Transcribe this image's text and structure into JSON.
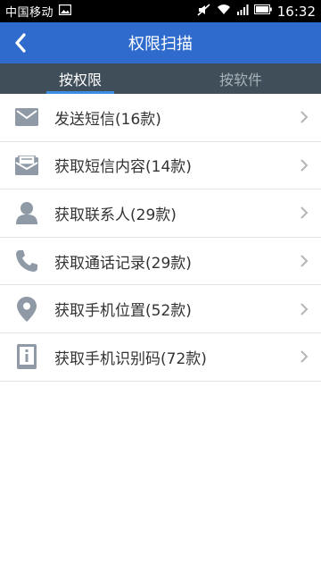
{
  "status_bar": {
    "carrier": "中国移动",
    "time": "16:32"
  },
  "app_bar": {
    "title": "权限扫描"
  },
  "tabs": [
    {
      "label": "按权限",
      "active": true
    },
    {
      "label": "按软件",
      "active": false
    }
  ],
  "list": [
    {
      "label": "发送短信(16款)",
      "icon": "envelope-icon"
    },
    {
      "label": "获取短信内容(14款)",
      "icon": "open-envelope-icon"
    },
    {
      "label": "获取联系人(29款)",
      "icon": "person-icon"
    },
    {
      "label": "获取通话记录(29款)",
      "icon": "phone-icon"
    },
    {
      "label": "获取手机位置(52款)",
      "icon": "location-pin-icon"
    },
    {
      "label": "获取手机识别码(72款)",
      "icon": "device-info-icon"
    }
  ],
  "colors": {
    "app_bar": "#2f6bcc",
    "tab_bar": "#3f4e59",
    "tab_indicator": "#3a8de0",
    "icon": "#8f9aa6"
  }
}
